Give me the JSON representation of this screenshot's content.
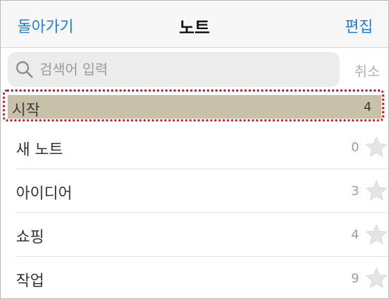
{
  "nav": {
    "back_label": "돌아가기",
    "title": "노트",
    "edit_label": "편집"
  },
  "search": {
    "placeholder": "검색어 입력",
    "cancel_label": "취소"
  },
  "selected_row": {
    "label": "시작",
    "count": "4"
  },
  "rows": [
    {
      "label": "새 노트",
      "count": "0",
      "icon": "star-icon"
    },
    {
      "label": "아이디어",
      "count": "3",
      "icon": "star-icon"
    },
    {
      "label": "쇼핑",
      "count": "4",
      "icon": "star-icon"
    },
    {
      "label": "작업",
      "count": "9",
      "icon": "star-icon"
    }
  ],
  "colors": {
    "accent": "#1f7fd9",
    "highlight_row": "#c8c0a9",
    "annotation_border": "#c0242b"
  }
}
